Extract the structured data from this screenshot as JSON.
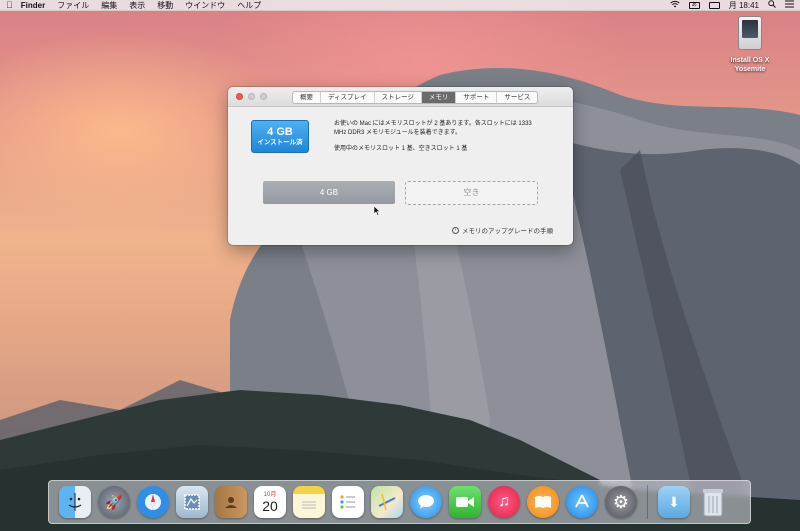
{
  "menubar": {
    "apple_icon": "apple-icon",
    "app_name": "Finder",
    "menus": [
      "ファイル",
      "編集",
      "表示",
      "移動",
      "ウインドウ",
      "ヘルプ"
    ],
    "status_icons": [
      "wifi-icon",
      "input-source-icon",
      "battery-icon"
    ],
    "clock": "月 18:41",
    "search_icon": "spotlight-icon",
    "list_icon": "notification-center-icon"
  },
  "desktop": {
    "icon_label": "Install OS X Yosemite"
  },
  "window": {
    "tabs": [
      {
        "label": "概要",
        "active": false
      },
      {
        "label": "ディスプレイ",
        "active": false
      },
      {
        "label": "ストレージ",
        "active": false
      },
      {
        "label": "メモリ",
        "active": true
      },
      {
        "label": "サポート",
        "active": false
      },
      {
        "label": "サービス",
        "active": false
      }
    ],
    "memory_badge": {
      "size": "4 GB",
      "status": "インストール済"
    },
    "description_1": "お使いの Mac にはメモリスロットが 2 基あります。各スロットには 1333 MHz DDR3 メモリモジュールを装着できます。",
    "description_2": "使用中のメモリスロット 1 基、空きスロット 1 基",
    "slot_1": "4 GB",
    "slot_2": "空き",
    "upgrade_link": "メモリのアップグレードの手順"
  },
  "dock": {
    "apps": [
      "Finder",
      "Launchpad",
      "Safari",
      "Mail",
      "Contacts",
      "Calendar",
      "Notes",
      "Reminders",
      "Maps",
      "Messages",
      "FaceTime",
      "iTunes",
      "iBooks",
      "App Store",
      "System Preferences"
    ],
    "calendar_date": "20",
    "calendar_month": "10月",
    "extras": [
      "Downloads",
      "Trash"
    ]
  },
  "colors": {
    "accent_blue": "#1f86d9",
    "active_tab": "#6b6b6b",
    "close_button": "#f25b54"
  }
}
